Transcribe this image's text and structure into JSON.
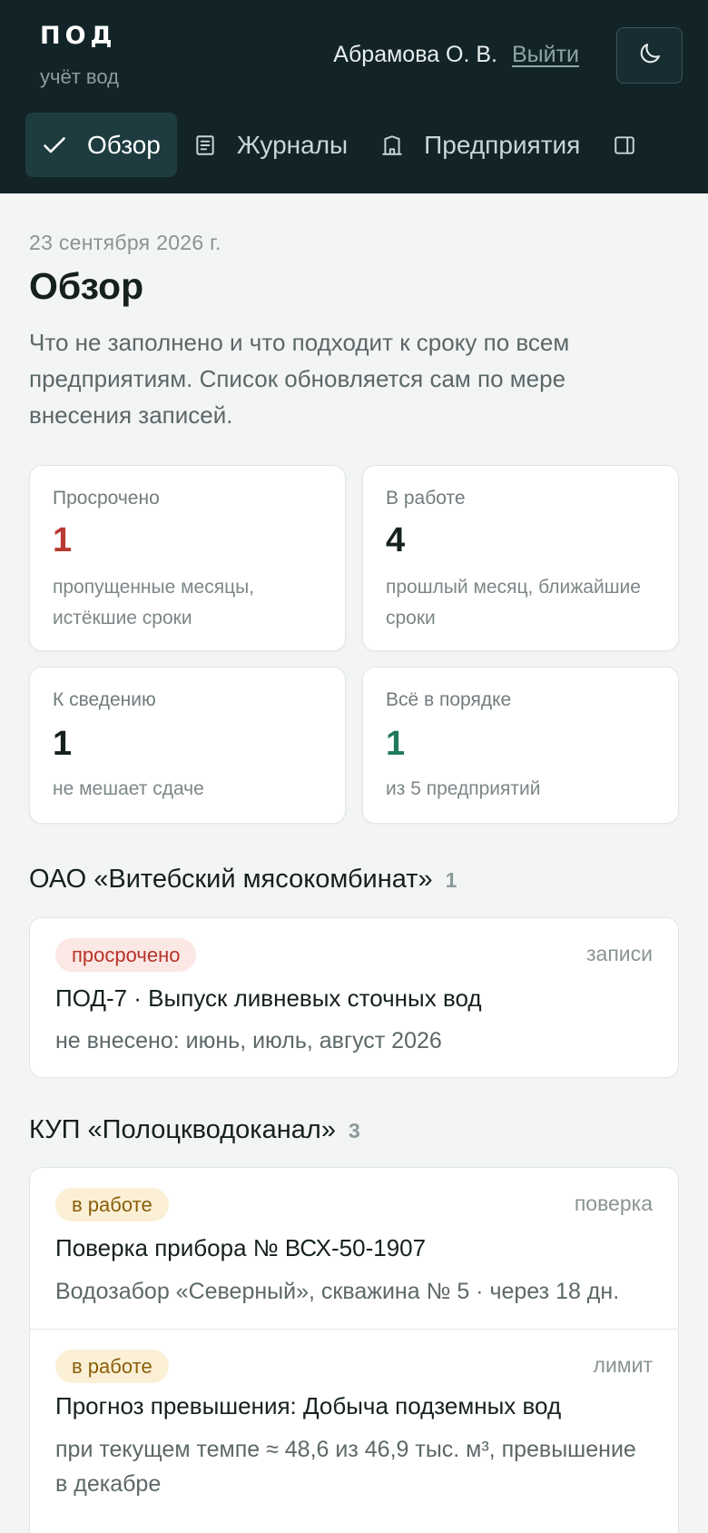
{
  "header": {
    "brand": "ПОД",
    "brand_sub": "учёт вод",
    "user": "Абрамова О. В.",
    "logout": "Выйти",
    "theme_icon": "moon-icon"
  },
  "nav": {
    "tabs": [
      {
        "label": "Обзор",
        "icon": "check-icon",
        "active": true
      },
      {
        "label": "Журналы",
        "icon": "document-icon"
      },
      {
        "label": "Предприятия",
        "icon": "building-icon"
      },
      {
        "label": "",
        "icon": "meter-icon"
      }
    ]
  },
  "page": {
    "date": "23 сентября 2026 г.",
    "title": "Обзор",
    "intro": "Что не заполнено и что подходит к сроку по всем предприятиям. Список обновляется сам по мере внесения записей."
  },
  "stats": [
    {
      "label": "Просрочено",
      "value": "1",
      "caption": "пропущенные месяцы, истёкшие сроки",
      "color": "#b93a32"
    },
    {
      "label": "В работе",
      "value": "4",
      "caption": "прошлый месяц, ближайшие сроки",
      "color": "#15201f"
    },
    {
      "label": "К сведению",
      "value": "1",
      "caption": "не мешает сдаче",
      "color": "#15201f"
    },
    {
      "label": "Всё в порядке",
      "value": "1",
      "caption": "из 5 предприятий",
      "color": "#1f7a5a"
    }
  ],
  "groups": [
    {
      "name": "ОАО «Витебский мясокомбинат»",
      "count": "1",
      "items": [
        {
          "status": "просрочено",
          "kind": "записи",
          "title": "ПОД-7 · Выпуск ливневых сточных вод",
          "desc": "не внесено: июнь, июль, август 2026"
        }
      ]
    },
    {
      "name": "КУП «Полоцкводоканал»",
      "count": "3",
      "items": [
        {
          "status": "в работе",
          "kind": "поверка",
          "title": "Поверка прибора № ВСХ-50-1907",
          "desc": "Водозабор «Северный», скважина № 5 · через 18 дн."
        },
        {
          "status": "в работе",
          "kind": "лимит",
          "title": "Прогноз превышения: Добыча подземных вод",
          "desc": "при текущем темпе ≈ 48,6 из 46,9 тыс. м³, превышение в декабре"
        }
      ]
    }
  ]
}
